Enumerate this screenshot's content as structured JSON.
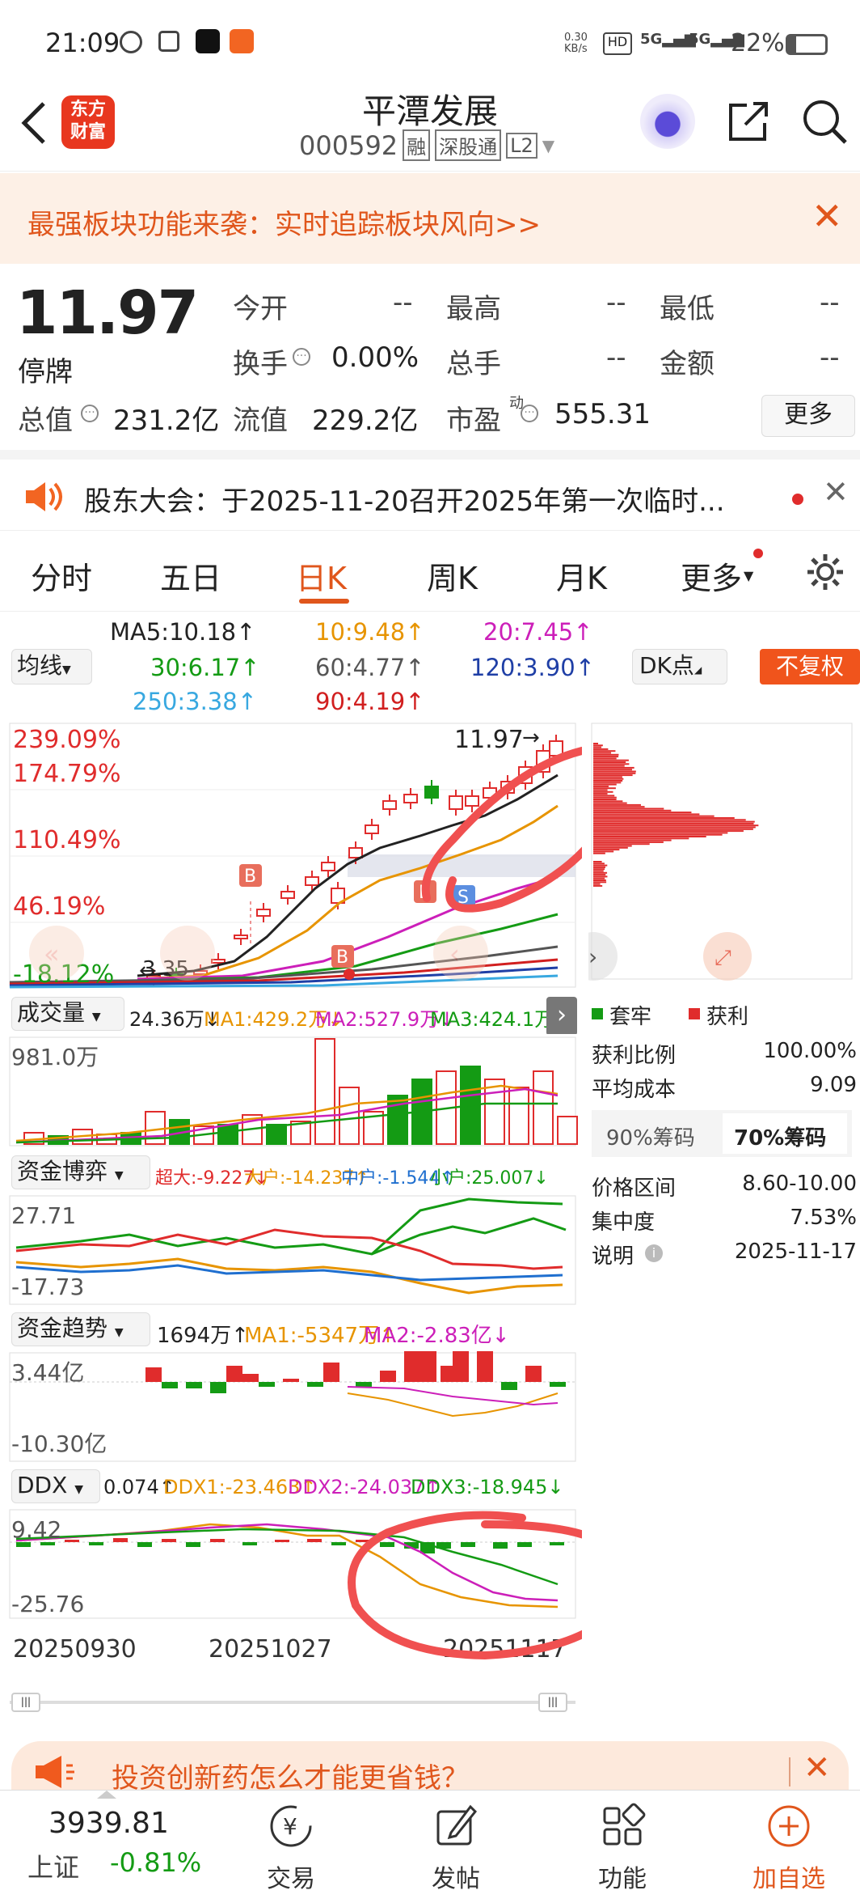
{
  "status": {
    "time": "21:09",
    "net": "0.30\nKB/s",
    "battery": "22%"
  },
  "header": {
    "logo": "东方\n财富",
    "title": "平潭发展",
    "code": "000592",
    "tags": [
      "融",
      "深股通",
      "L2"
    ]
  },
  "banner": {
    "text": "最强板块功能来袭：实时追踪板块风向>>"
  },
  "quote": {
    "price": "11.97",
    "status": "停牌",
    "cells": [
      {
        "k": "今开",
        "v": "--"
      },
      {
        "k": "最高",
        "v": "--"
      },
      {
        "k": "最低",
        "v": "--"
      },
      {
        "k": "换手",
        "v": "0.00%"
      },
      {
        "k": "总手",
        "v": "--"
      },
      {
        "k": "金额",
        "v": "--"
      }
    ],
    "total_k": "总值",
    "total_v": "231.2亿",
    "float_k": "流值",
    "float_v": "229.2亿",
    "pe_k": "市盈",
    "pe_sup": "动",
    "pe_v": "555.31",
    "more": "更多"
  },
  "notice": {
    "text": "股东大会：于2025-11-20召开2025年第一次临时..."
  },
  "tabs": [
    "分时",
    "五日",
    "日K",
    "周K",
    "月K",
    "更多"
  ],
  "ma": {
    "selector": "均线",
    "ma5": "MA5:10.18↑",
    "ma10": "10:9.48↑",
    "ma20": "20:7.45↑",
    "ma30": "30:6.17↑",
    "ma60": "60:4.77↑",
    "ma120": "120:3.90↑",
    "ma250": "250:3.38↑",
    "ma90": "90:4.19↑",
    "dk": "DK点",
    "fq": "不复权"
  },
  "kline": {
    "p1": "239.09%",
    "p2": "174.79%",
    "p3": "110.49%",
    "p4": "46.19%",
    "p5": "-18.12%",
    "last": "11.97",
    "low": "3.35",
    "marks": [
      "B",
      "B",
      "B",
      "S",
      "B"
    ]
  },
  "chips": {
    "legend1": "套牢",
    "legend2": "获利",
    "rows": [
      {
        "k": "获利比例",
        "v": "100.00%"
      },
      {
        "k": "平均成本",
        "v": "9.09"
      }
    ],
    "tab90": "90%筹码",
    "tab70": "70%筹码",
    "rows2": [
      {
        "k": "价格区间",
        "v": "8.60-10.00"
      },
      {
        "k": "集中度",
        "v": "7.53%"
      },
      {
        "k": "说明",
        "v": "2025-11-17"
      }
    ]
  },
  "vol": {
    "label": "成交量",
    "v": "24.36万↓",
    "ma1": "MA1:429.2万↓",
    "ma2": "MA2:527.9万↓",
    "ma3": "MA3:424.1万↓",
    "max": "981.0万"
  },
  "zjbo": {
    "label": "资金博弈",
    "a": "超大:-9.227↓",
    "b": "大户:-14.237↑",
    "c": "中户:-1.544↑",
    "d": "小户:25.007↓",
    "max": "27.71",
    "min": "-17.73"
  },
  "zjqs": {
    "label": "资金趋势",
    "v": "1694万↑",
    "ma1": "MA1:-5347万↑",
    "ma2": "MA2:-2.83亿↓",
    "max": "3.44亿",
    "min": "-10.30亿"
  },
  "ddx": {
    "label": "DDX",
    "v": "0.074↑",
    "d1": "DDX1:-23.463↑",
    "d2": "DDX2:-24.037↑",
    "d3": "DDX3:-18.945↓",
    "max": "9.42",
    "min": "-25.76"
  },
  "dates": [
    "20250930",
    "20251027",
    "20251117"
  ],
  "ad": {
    "text": "投资创新药怎么才能更省钱？"
  },
  "bottom": {
    "index_v": "3939.81",
    "index_n": "上证",
    "index_c": "-0.81%",
    "items": [
      "交易",
      "发帖",
      "功能",
      "加自选"
    ]
  }
}
